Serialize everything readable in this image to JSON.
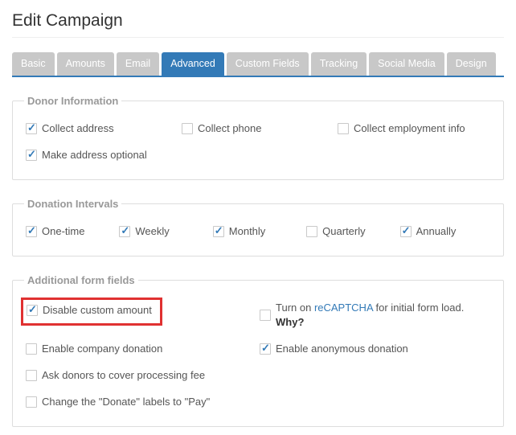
{
  "page": {
    "title": "Edit Campaign"
  },
  "tabs": [
    {
      "label": "Basic",
      "active": false
    },
    {
      "label": "Amounts",
      "active": false
    },
    {
      "label": "Email",
      "active": false
    },
    {
      "label": "Advanced",
      "active": true
    },
    {
      "label": "Custom Fields",
      "active": false
    },
    {
      "label": "Tracking",
      "active": false
    },
    {
      "label": "Social Media",
      "active": false
    },
    {
      "label": "Design",
      "active": false
    }
  ],
  "groups": {
    "donor_info": {
      "legend": "Donor Information",
      "collect_address": {
        "label": "Collect address",
        "checked": true
      },
      "collect_phone": {
        "label": "Collect phone",
        "checked": false
      },
      "collect_employment": {
        "label": "Collect employment info",
        "checked": false
      },
      "address_optional": {
        "label": "Make address optional",
        "checked": true
      }
    },
    "intervals": {
      "legend": "Donation Intervals",
      "one_time": {
        "label": "One-time",
        "checked": true
      },
      "weekly": {
        "label": "Weekly",
        "checked": true
      },
      "monthly": {
        "label": "Monthly",
        "checked": true
      },
      "quarterly": {
        "label": "Quarterly",
        "checked": false
      },
      "annually": {
        "label": "Annually",
        "checked": true
      }
    },
    "additional": {
      "legend": "Additional form fields",
      "disable_custom_amount": {
        "label": "Disable custom amount",
        "checked": true
      },
      "recaptcha_prefix": "Turn on ",
      "recaptcha_link": "reCAPTCHA",
      "recaptcha_mid": " for initial form load. ",
      "recaptcha_why": "Why?",
      "recaptcha_checked": false,
      "enable_company": {
        "label": "Enable company donation",
        "checked": false
      },
      "enable_anonymous": {
        "label": "Enable anonymous donation",
        "checked": true
      },
      "cover_fee": {
        "label": "Ask donors to cover processing fee",
        "checked": false
      },
      "pay_labels": {
        "label": "Change the \"Donate\" labels to \"Pay\"",
        "checked": false
      }
    }
  }
}
